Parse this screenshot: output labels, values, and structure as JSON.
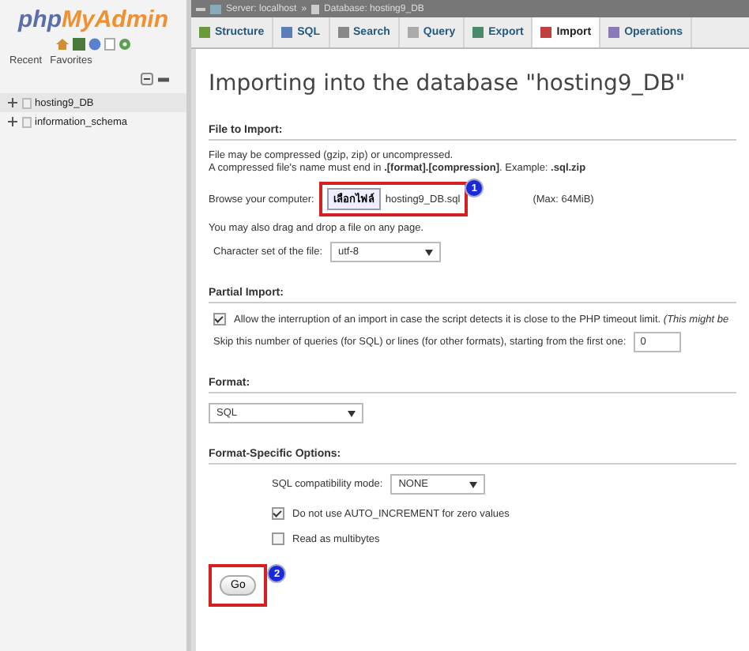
{
  "sidebar": {
    "logo_prefix": "php",
    "logo_main": "MyAdmin",
    "tabs": [
      {
        "label": "Recent",
        "selected": false
      },
      {
        "label": "Favorites",
        "selected": false
      }
    ],
    "databases": [
      {
        "name": "hosting9_DB",
        "selected": true
      },
      {
        "name": "information_schema",
        "selected": false
      }
    ]
  },
  "breadcrumb": {
    "server": "Server: localhost",
    "separator": "»",
    "database": "Database: hosting9_DB"
  },
  "tabs": [
    {
      "label": "Structure",
      "selected": false
    },
    {
      "label": "SQL",
      "selected": false
    },
    {
      "label": "Search",
      "selected": false
    },
    {
      "label": "Query",
      "selected": false
    },
    {
      "label": "Export",
      "selected": false
    },
    {
      "label": "Import",
      "selected": true
    },
    {
      "label": "Operations",
      "selected": false
    }
  ],
  "heading": "Importing into the database \"hosting9_DB\"",
  "file_section": {
    "title": "File to Import:",
    "note_1": "File may be compressed (gzip, zip) or uncompressed.",
    "note_2": "A compressed file's name must end in **.[format].[compression]**. Example: **.sql.zip**",
    "browse_label": "Browse your computer:",
    "browse_button": "เลือกไฟล์",
    "file_name": "hosting9_DB.sql",
    "badge": "1",
    "max": "(Max: 64MiB)",
    "drag_note": "You may also drag and drop a file on any page.",
    "charset_label": "Character set of the file:",
    "charset": "utf-8"
  },
  "partial_section": {
    "title": "Partial Import:",
    "allow_interrupt": {
      "checked": true,
      "label": "Allow the interruption of an import in case the script detects it is close to the PHP timeout limit. *(This might be*"
    },
    "skip_label": "Skip this number of queries (for SQL) or lines (for other formats), starting from the first one:",
    "skip_value": "0"
  },
  "format_section": {
    "title": "Format:",
    "format": "SQL"
  },
  "options_section": {
    "title": "Format-Specific Options:",
    "compat_label": "SQL compatibility mode:",
    "compat": "NONE",
    "options": [
      {
        "label": "Do not use AUTO_INCREMENT for zero values",
        "checked": true
      },
      {
        "label": "Read as multibytes",
        "checked": false
      }
    ]
  },
  "go_button": "Go",
  "go_badge": "2"
}
